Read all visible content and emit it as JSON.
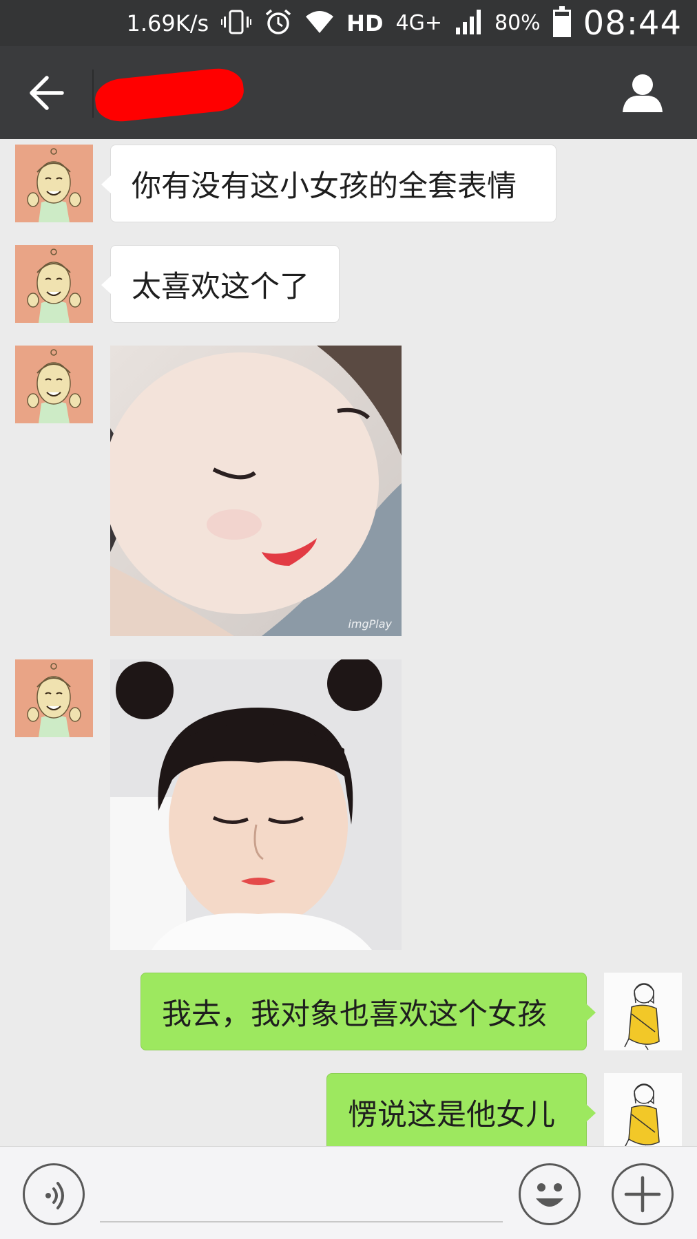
{
  "status_bar": {
    "speed": "1.69K/s",
    "hd": "HD",
    "network": "4G+",
    "battery_percent": "80%",
    "battery_level": 0.8,
    "time": "08:44",
    "icons": [
      "vibrate-icon",
      "alarm-icon",
      "wifi-icon",
      "signal-icon",
      "battery-icon"
    ]
  },
  "header": {
    "back_icon": "arrow-left-icon",
    "title": "",
    "title_redacted": true,
    "profile_icon": "person-icon"
  },
  "messages": [
    {
      "direction": "incoming",
      "type": "text",
      "text": "你有没有这小女孩的全套表情"
    },
    {
      "direction": "incoming",
      "type": "text",
      "text": "太喜欢这个了"
    },
    {
      "direction": "incoming",
      "type": "image",
      "description": "smiling-girl-sticker",
      "watermark": "imgPlay"
    },
    {
      "direction": "incoming",
      "type": "image",
      "description": "girl-with-buns-sticker"
    },
    {
      "direction": "outgoing",
      "type": "text",
      "text": "我去，我对象也喜欢这个女孩"
    },
    {
      "direction": "outgoing",
      "type": "text",
      "text": "愣说这是他女儿"
    }
  ],
  "input_bar": {
    "voice_icon": "voice-icon",
    "emoji_icon": "emoji-icon",
    "plus_icon": "plus-icon",
    "placeholder": ""
  },
  "colors": {
    "status_bar": "#343536",
    "header": "#3a3b3d",
    "chat_background": "#ebebeb",
    "incoming_bubble": "#ffffff",
    "outgoing_bubble": "#9de85f",
    "redaction": "#ff0000"
  }
}
